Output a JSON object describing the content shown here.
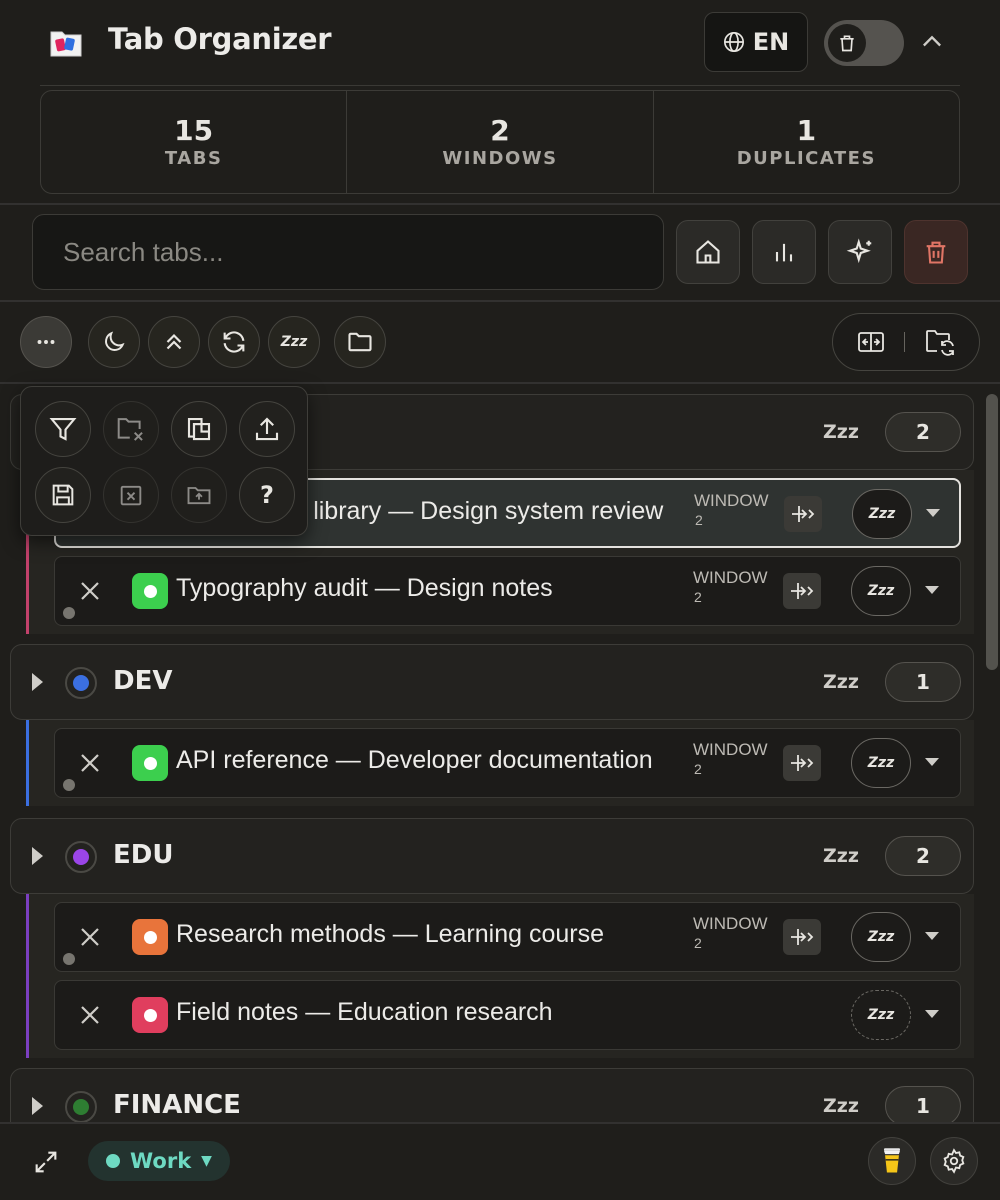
{
  "header": {
    "title": "Tab Organizer",
    "language": "EN"
  },
  "stats": [
    {
      "value": "15",
      "label": "TABS"
    },
    {
      "value": "2",
      "label": "WINDOWS"
    },
    {
      "value": "1",
      "label": "DUPLICATES"
    }
  ],
  "search": {
    "placeholder": "Search tabs..."
  },
  "actions": {
    "snooze_label": "Zzz"
  },
  "groups": [
    {
      "name": "",
      "color": "#c2416b",
      "snooze": "Zzz",
      "count": "2",
      "tabs": [
        {
          "title": "Component library — Design system review",
          "window_label": "WINDOW",
          "window_num": "2",
          "favicon_color": "#ffffff",
          "snooze": "Zzz",
          "selected": true
        },
        {
          "title": "Typography audit — Design notes",
          "window_label": "WINDOW",
          "window_num": "2",
          "favicon_color": "#3ccf4e",
          "snooze": "Zzz"
        }
      ]
    },
    {
      "name": "DEV",
      "color": "#3b6fe0",
      "snooze": "Zzz",
      "count": "1",
      "tabs": [
        {
          "title": "API reference — Developer documentation",
          "window_label": "WINDOW",
          "window_num": "2",
          "favicon_color": "#3ccf4e",
          "snooze": "Zzz"
        }
      ]
    },
    {
      "name": "EDU",
      "color": "#9b45e8",
      "snooze": "Zzz",
      "count": "2",
      "tabs": [
        {
          "title": "Research methods — Learning course",
          "window_label": "WINDOW",
          "window_num": "2",
          "favicon_color": "#e8743b",
          "snooze": "Zzz"
        },
        {
          "title": "Field notes — Education research",
          "favicon_color": "#e03e5e",
          "snooze": "Zzz"
        }
      ]
    },
    {
      "name": "FINANCE",
      "color": "#2e7d32",
      "snooze": "Zzz",
      "count": "1"
    }
  ],
  "menu": {
    "help": "?"
  },
  "footer": {
    "workspace": "Work",
    "workspace_caret": "▼",
    "workspace_color": "#6ed9c2"
  }
}
